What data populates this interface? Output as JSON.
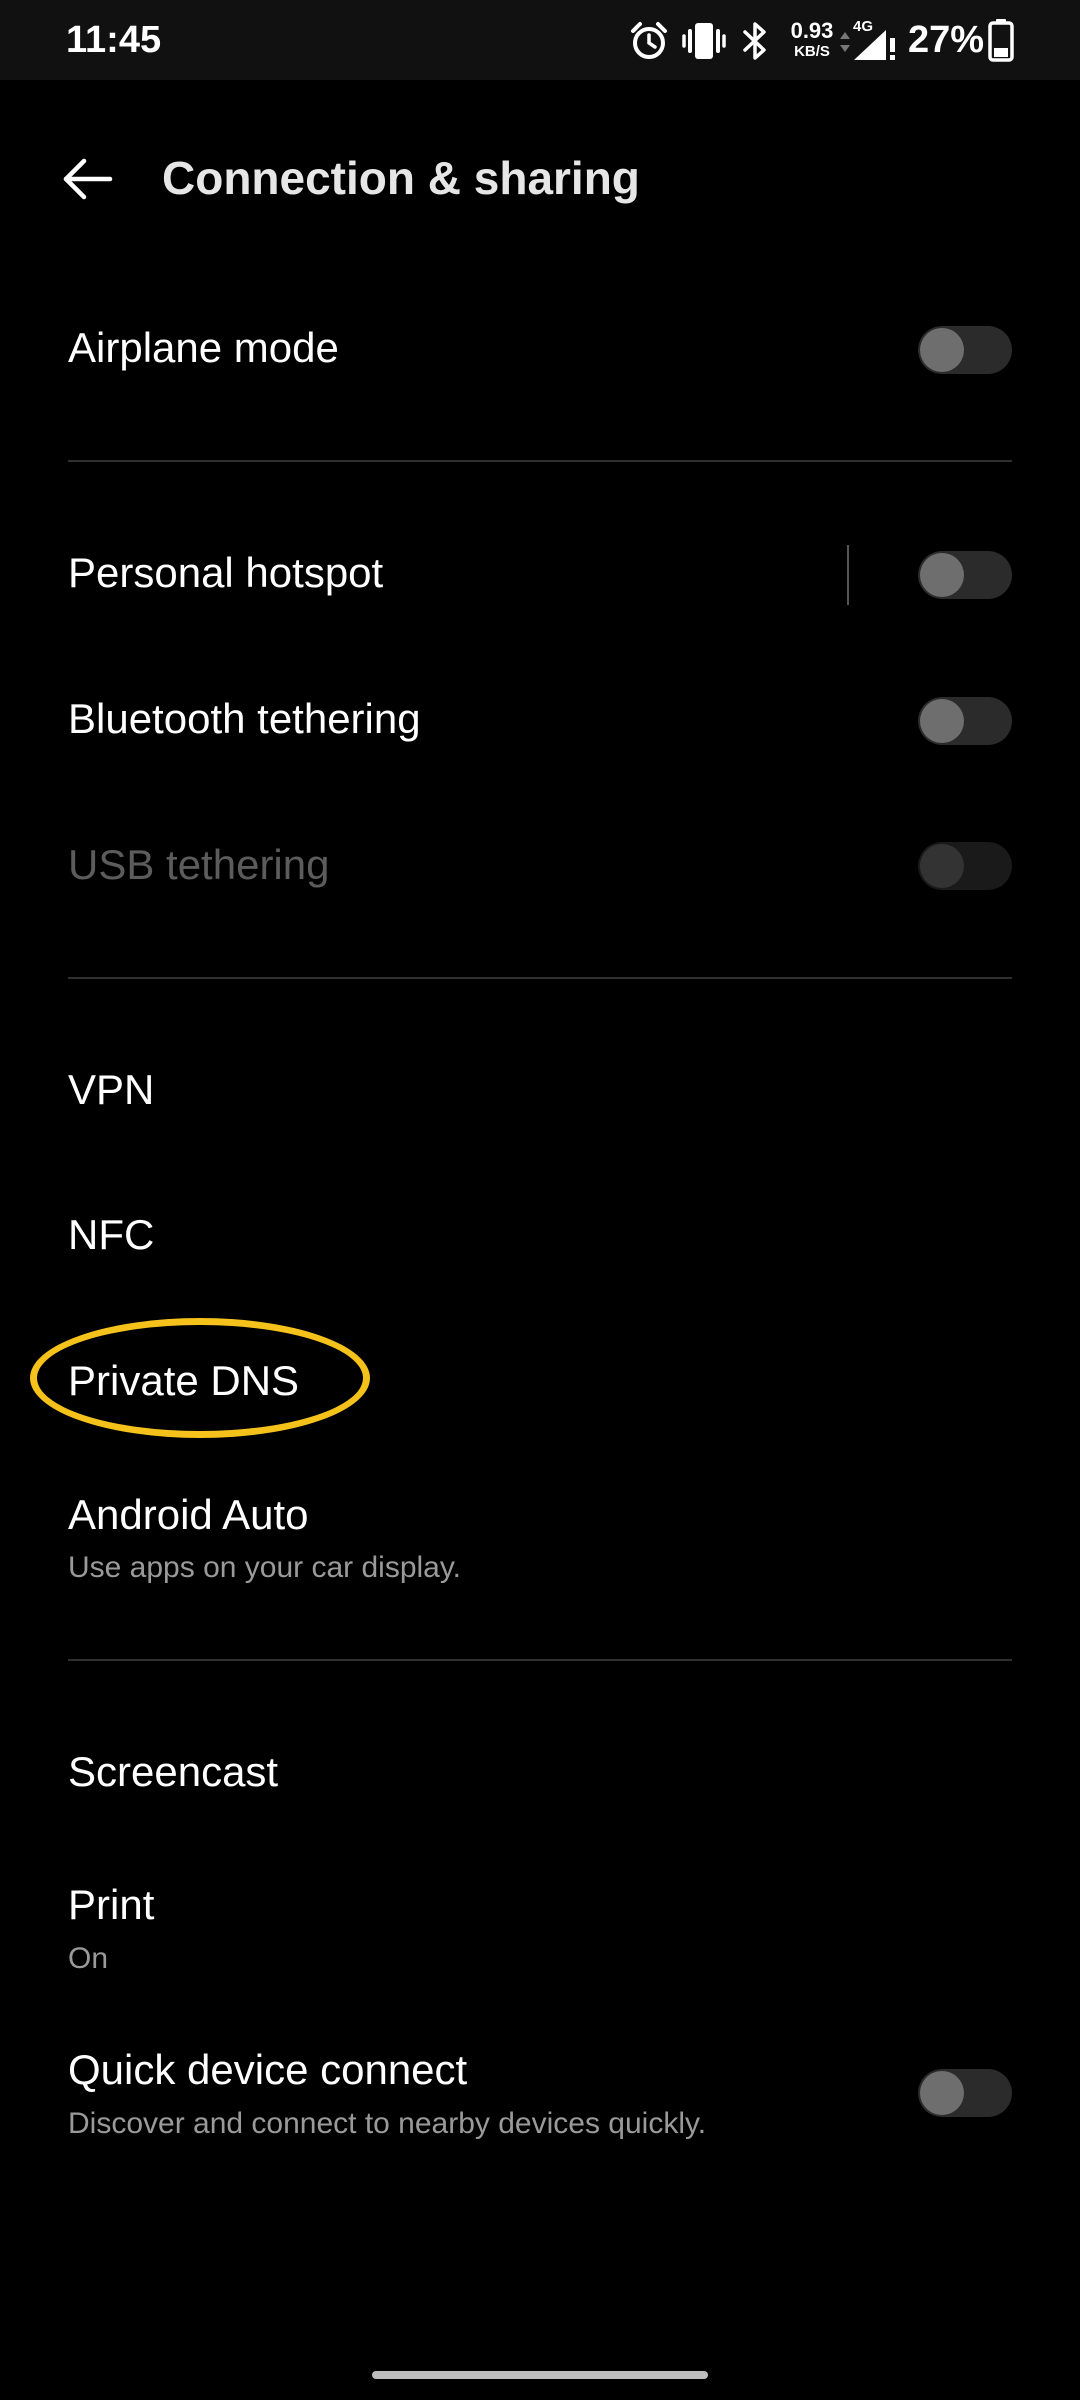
{
  "status_bar": {
    "time": "11:45",
    "net_speed_value": "0.93",
    "net_speed_unit": "KB/S",
    "network_type": "4G",
    "battery_percent": "27%",
    "icons": [
      "alarm-icon",
      "vibrate-icon",
      "bluetooth-icon",
      "data-arrows-icon",
      "signal-icon",
      "battery-icon"
    ]
  },
  "header": {
    "title": "Connection & sharing",
    "back_icon": "back-arrow-icon"
  },
  "rows": {
    "airplane_mode": {
      "title": "Airplane mode",
      "toggle_on": false
    },
    "personal_hotspot": {
      "title": "Personal hotspot",
      "toggle_on": false
    },
    "bluetooth_tethering": {
      "title": "Bluetooth tethering",
      "toggle_on": false
    },
    "usb_tethering": {
      "title": "USB tethering",
      "toggle_on": false,
      "disabled": true
    },
    "vpn": {
      "title": "VPN"
    },
    "nfc": {
      "title": "NFC"
    },
    "private_dns": {
      "title": "Private DNS"
    },
    "android_auto": {
      "title": "Android Auto",
      "subtitle": "Use apps on your car display."
    },
    "screencast": {
      "title": "Screencast"
    },
    "print": {
      "title": "Print",
      "subtitle": "On"
    },
    "quick_device_connect": {
      "title": "Quick device connect",
      "subtitle": "Discover and connect to nearby devices quickly.",
      "toggle_on": false
    }
  },
  "colors": {
    "background": "#000000",
    "highlight": "#f5c21b",
    "toggle_track": "#2b2b2b",
    "toggle_knob": "#6e6e6e",
    "subtitle": "#9a9a9a",
    "disabled_text": "#5c5c5c"
  }
}
